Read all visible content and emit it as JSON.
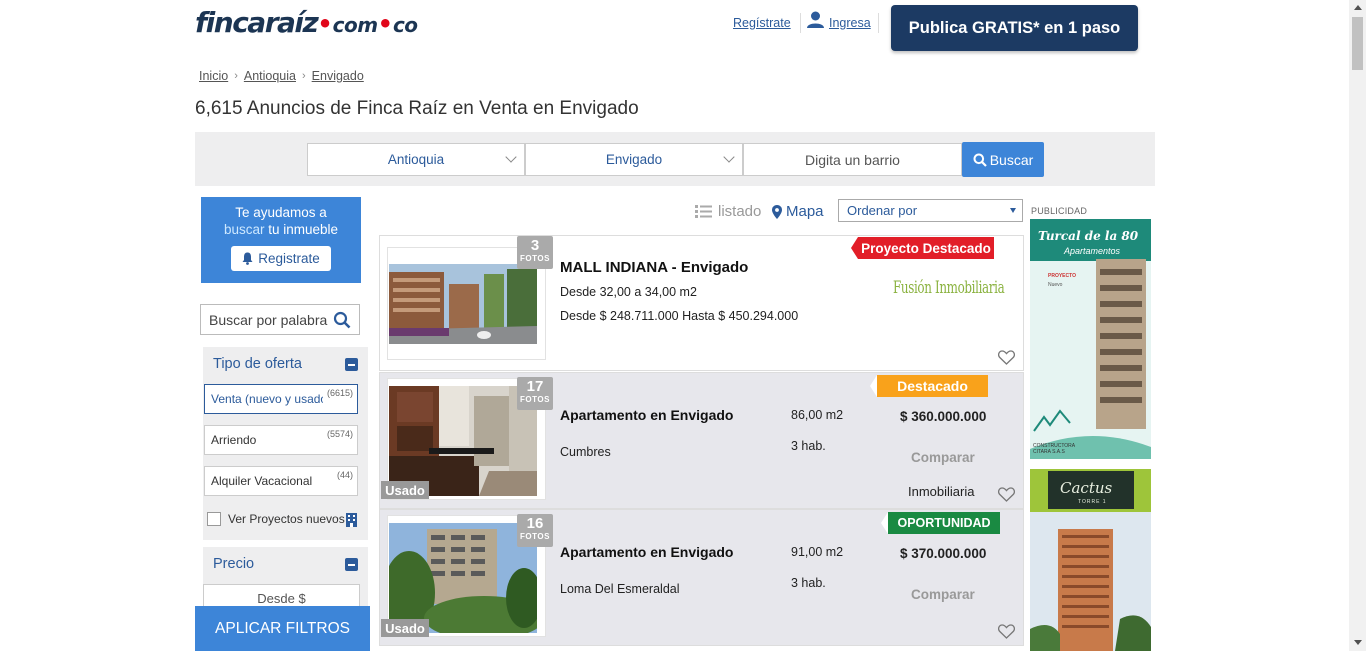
{
  "header": {
    "logo_main": "fincaraíz",
    "logo_sub_1": "com",
    "logo_sub_2": "co",
    "register_link": "Regístrate",
    "login_link": "Ingresa",
    "publish_button": "Publica GRATIS* en 1 paso"
  },
  "breadcrumb": [
    "Inicio",
    "Antioquia",
    "Envigado"
  ],
  "page_title": "6,615 Anuncios de Finca Raíz en Venta en Envigado",
  "search": {
    "department": "Antioquia",
    "city": "Envigado",
    "barrio_placeholder": "Digita un barrio",
    "buscar_button": "Buscar"
  },
  "sidebar": {
    "help_line1": "Te ayudamos a",
    "help_highlight": "buscar",
    "help_rest": " tu inmueble",
    "help_register": "Registrate",
    "keyword_placeholder": "Buscar por palabra",
    "tipo_oferta_title": "Tipo de oferta",
    "offers": [
      {
        "label": "Venta (nuevo y usado)",
        "count": "(6615)"
      },
      {
        "label": "Arriendo",
        "count": "(5574)"
      },
      {
        "label": "Alquiler Vacacional",
        "count": "(44)"
      }
    ],
    "ver_proyectos": "Ver Proyectos nuevos",
    "precio_title": "Precio",
    "desde_placeholder": "Desde $",
    "apply_button": "APLICAR FILTROS"
  },
  "list_controls": {
    "listado": "listado",
    "mapa": "Mapa",
    "order_by": "Ordenar por"
  },
  "listings": [
    {
      "ribbon": "Proyecto Destacado",
      "ribbon_color": "#e21e28",
      "photos": "3",
      "fotos_label": "FOTOS",
      "title": "MALL INDIANA - Envigado",
      "line1": "Desde 32,00 a 34,00 m2",
      "line2": "Desde $ 248.711.000 Hasta $ 450.294.000",
      "agency_logo": "Fusión Inmobiliaria"
    },
    {
      "ribbon": "Destacado",
      "ribbon_color": "#f9a21b",
      "photos": "17",
      "fotos_label": "FOTOS",
      "usado": "Usado",
      "title": "Apartamento en Envigado",
      "area": "86,00 m2",
      "price": "$ 360.000.000",
      "location": "Cumbres",
      "rooms": "3 hab.",
      "compare": "Comparar",
      "seller": "Inmobiliaria"
    },
    {
      "ribbon": "OPORTUNIDAD",
      "ribbon_color": "#1a8a42",
      "photos": "16",
      "fotos_label": "FOTOS",
      "usado": "Usado",
      "title": "Apartamento en Envigado",
      "area": "91,00 m2",
      "price": "$ 370.000.000",
      "location": "Loma Del Esmeraldal",
      "rooms": "3 hab.",
      "compare": "Comparar"
    }
  ],
  "ads": {
    "label": "PUBLICIDAD",
    "ad1_title": "Turcal de la 80",
    "ad1_subtitle": "Apartamentos",
    "ad1_tag": "PROYECTO",
    "ad1_tag2": "Nuevo",
    "ad1_footer": "CONSTRUCTORA CITARA S.A.S",
    "ad2_title": "Cactus",
    "ad2_subtitle": "TORRE 1"
  },
  "colors": {
    "brand_navy": "#1c3a63",
    "accent_blue": "#3d85d8",
    "link_blue": "#2c5b9b",
    "logo_red": "#e1061a"
  }
}
